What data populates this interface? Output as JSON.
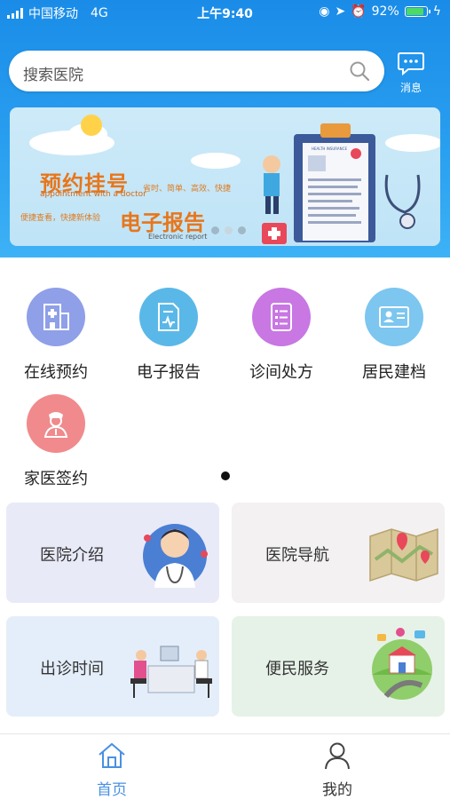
{
  "status_bar": {
    "carrier": "中国移动",
    "network": "4G",
    "time": "上午9:40",
    "battery": "92%",
    "battery_level": 0.92
  },
  "search": {
    "placeholder": "搜索医院"
  },
  "message": {
    "label": "消息"
  },
  "banner": {
    "title1": "预约挂号",
    "title1_en": "appointment with a doctor",
    "tagline1": "省时、简单、高效、快捷",
    "tagline2": "便捷查看，快捷新体验",
    "title2": "电子报告",
    "title2_en": "Electronic report",
    "chart_label": "HEALTH INSURANCE",
    "slide_count": 3,
    "active_slide": 1
  },
  "services": [
    {
      "label": "在线预约",
      "icon": "hospital-building-icon",
      "color": "#8f9fe8"
    },
    {
      "label": "电子报告",
      "icon": "report-document-icon",
      "color": "#5ab8e8"
    },
    {
      "label": "诊间处方",
      "icon": "prescription-list-icon",
      "color": "#c877e3"
    },
    {
      "label": "居民建档",
      "icon": "id-card-icon",
      "color": "#7cc6f0"
    },
    {
      "label": "家医签约",
      "icon": "doctor-icon",
      "color": "#f08a8c"
    }
  ],
  "cards": [
    {
      "label": "医院介绍",
      "bg": "#e9eaf8"
    },
    {
      "label": "医院导航",
      "bg": "#f3f1f2"
    },
    {
      "label": "出诊时间",
      "bg": "#e4eefa"
    },
    {
      "label": "便民服务",
      "bg": "#e6f2e8"
    }
  ],
  "tabs": [
    {
      "label": "首页",
      "active": true,
      "color": "#4a90e2"
    },
    {
      "label": "我的",
      "active": false,
      "color": "#333333"
    }
  ]
}
